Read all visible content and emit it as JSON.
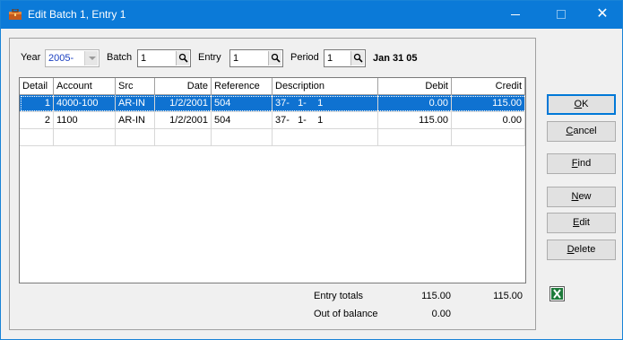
{
  "window": {
    "title": "Edit Batch 1, Entry 1",
    "minimize_glyph": "",
    "maximize_glyph": "",
    "close_glyph": "✕"
  },
  "filters": {
    "year_label": "Year",
    "year_value": "2005-",
    "batch_label": "Batch",
    "batch_value": "1",
    "entry_label": "Entry",
    "entry_value": "1",
    "period_label": "Period",
    "period_value": "1",
    "period_date": "Jan 31 05"
  },
  "grid": {
    "columns": [
      "Detail",
      "Account",
      "Src",
      "Date",
      "Reference",
      "Description",
      "Debit",
      "Credit"
    ],
    "rows": [
      {
        "detail": "1",
        "account": "4000-100",
        "src": "AR-IN",
        "date": "1/2/2001",
        "reference": "504",
        "description": "37-   1-    1",
        "debit": "0.00",
        "credit": "115.00",
        "selected": true
      },
      {
        "detail": "2",
        "account": "1100",
        "src": "AR-IN",
        "date": "1/2/2001",
        "reference": "504",
        "description": "37-   1-    1",
        "debit": "115.00",
        "credit": "0.00",
        "selected": false
      }
    ]
  },
  "totals": {
    "entry_totals_label": "Entry totals",
    "entry_debit": "115.00",
    "entry_credit": "115.00",
    "out_of_balance_label": "Out of balance",
    "out_of_balance": "0.00"
  },
  "buttons": {
    "ok": {
      "hot": "O",
      "rest": "K"
    },
    "cancel": {
      "hot": "C",
      "rest": "ancel"
    },
    "find": {
      "hot": "F",
      "rest": "ind"
    },
    "new": {
      "hot": "N",
      "rest": "ew"
    },
    "edit": {
      "hot": "E",
      "rest": "dit"
    },
    "delete": {
      "hot": "D",
      "rest": "elete"
    }
  },
  "icons": {
    "app": "briefcase-icon",
    "lookup": "magnifier-icon",
    "export": "excel-icon"
  },
  "colors": {
    "titlebar": "#0b7ad8",
    "selection": "#0f72d1",
    "year_text": "#1a3fc0"
  }
}
